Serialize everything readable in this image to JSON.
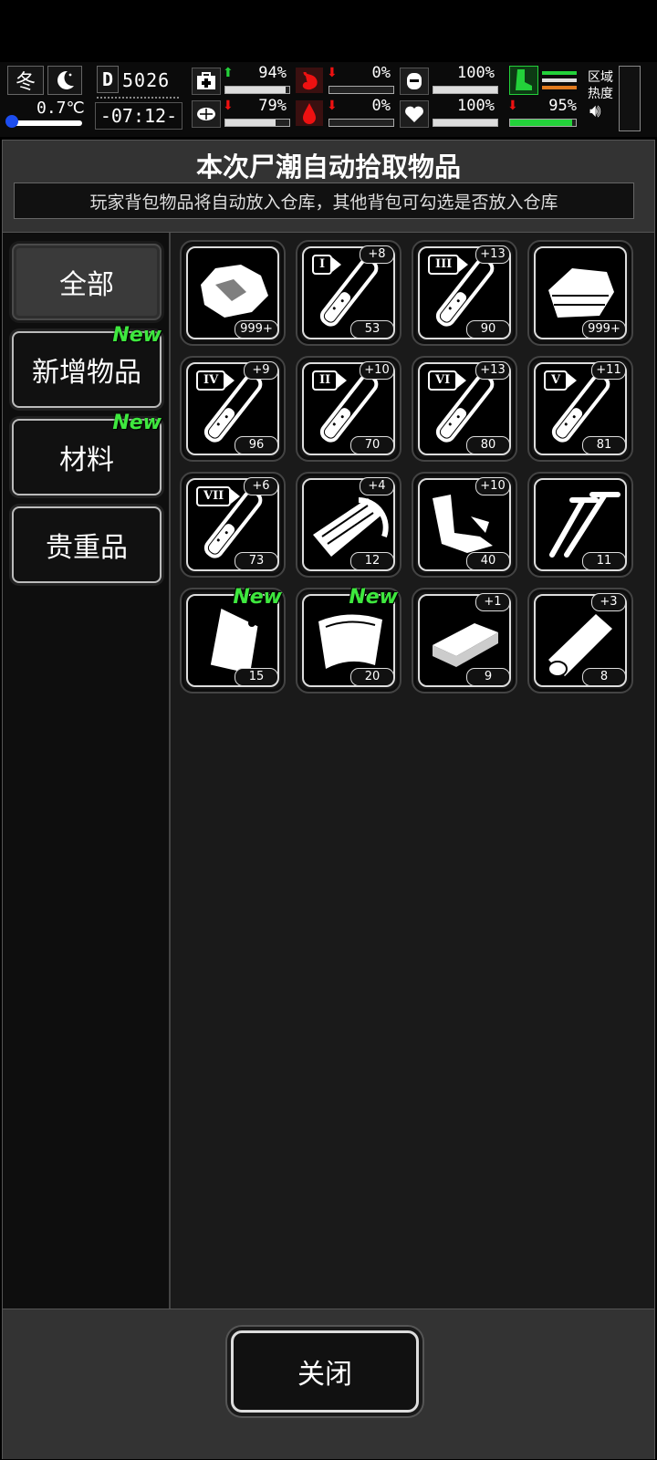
{
  "hud": {
    "season": "冬",
    "temperature": "0.7℃",
    "day_label": "D",
    "day_number": "5026",
    "clock": "-07:12-",
    "stats": [
      {
        "name": "health",
        "value": "94%",
        "trend": "up",
        "level": 0.94
      },
      {
        "name": "hunger",
        "value": "0%",
        "trend": "down",
        "level": 0.0
      },
      {
        "name": "water",
        "value": "100%",
        "trend": "none",
        "level": 1.0
      },
      {
        "name": "mood",
        "value": "79%",
        "trend": "down",
        "level": 0.79
      },
      {
        "name": "blood",
        "value": "0%",
        "trend": "down",
        "level": 0.0
      },
      {
        "name": "heart",
        "value": "100%",
        "trend": "none",
        "level": 1.0
      },
      {
        "name": "stamina",
        "value": "95%",
        "trend": "down",
        "level": 0.95
      }
    ],
    "zone_label_line1": "区域",
    "zone_label_line2": "热度"
  },
  "panel": {
    "title": "本次尸潮自动拾取物品",
    "subtitle": "玩家背包物品将自动放入仓库，其他背包可勾选是否放入仓库"
  },
  "tabs": [
    {
      "label": "全部",
      "active": true,
      "new": ""
    },
    {
      "label": "新增物品",
      "active": false,
      "new": "New"
    },
    {
      "label": "材料",
      "active": false,
      "new": "New"
    },
    {
      "label": "贵重品",
      "active": false,
      "new": ""
    }
  ],
  "items": [
    {
      "icon": "rock-icon",
      "count": "999+",
      "bonus": "",
      "new": "",
      "tier": ""
    },
    {
      "icon": "vial-icon",
      "count": "53",
      "bonus": "+8",
      "new": "",
      "tier": "I"
    },
    {
      "icon": "vial-icon",
      "count": "90",
      "bonus": "+13",
      "new": "",
      "tier": "III"
    },
    {
      "icon": "cloth-icon",
      "count": "999+",
      "bonus": "",
      "new": "",
      "tier": ""
    },
    {
      "icon": "vial-icon",
      "count": "96",
      "bonus": "+9",
      "new": "",
      "tier": "IV"
    },
    {
      "icon": "vial-icon",
      "count": "70",
      "bonus": "+10",
      "new": "",
      "tier": "II"
    },
    {
      "icon": "vial-icon",
      "count": "80",
      "bonus": "+13",
      "new": "",
      "tier": "VI"
    },
    {
      "icon": "vial-icon",
      "count": "81",
      "bonus": "+11",
      "new": "",
      "tier": "V"
    },
    {
      "icon": "vial-icon",
      "count": "73",
      "bonus": "+6",
      "new": "",
      "tier": "VII"
    },
    {
      "icon": "wood-icon",
      "count": "12",
      "bonus": "+4",
      "new": "",
      "tier": ""
    },
    {
      "icon": "scrap-metal-icon",
      "count": "40",
      "bonus": "+10",
      "new": "",
      "tier": ""
    },
    {
      "icon": "nails-icon",
      "count": "11",
      "bonus": "",
      "new": "",
      "tier": ""
    },
    {
      "icon": "bag-icon",
      "count": "15",
      "bonus": "",
      "new": "New",
      "tier": ""
    },
    {
      "icon": "leather-icon",
      "count": "20",
      "bonus": "",
      "new": "New",
      "tier": ""
    },
    {
      "icon": "bar-icon",
      "count": "9",
      "bonus": "+1",
      "new": "",
      "tier": ""
    },
    {
      "icon": "log-icon",
      "count": "8",
      "bonus": "+3",
      "new": "",
      "tier": ""
    }
  ],
  "close_label": "关闭",
  "colors": {
    "accent_new": "#3ee83e",
    "stat_green": "#23d13a",
    "temp_blue": "#1c4df0"
  }
}
